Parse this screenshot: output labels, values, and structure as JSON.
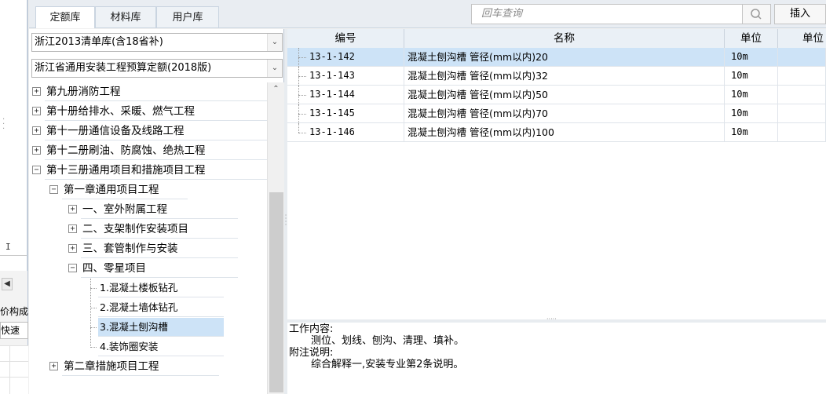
{
  "tabs": [
    "定额库",
    "材料库",
    "用户库"
  ],
  "search": {
    "placeholder": "回车查询"
  },
  "insert_label": "插入",
  "left_stub": {
    "label1": "价构成",
    "label2": "快速",
    "cursor": "I"
  },
  "library_combo": "浙江2013清单库(含18省补)",
  "quota_combo": "浙江省通用安装工程预算定额(2018版)",
  "tree": [
    {
      "label": "第九册消防工程",
      "exp": "+"
    },
    {
      "label": "第十册给排水、采暖、燃气工程",
      "exp": "+"
    },
    {
      "label": "第十一册通信设备及线路工程",
      "exp": "+"
    },
    {
      "label": "第十二册刷油、防腐蚀、绝热工程",
      "exp": "+"
    },
    {
      "label": "第十三册通用项目和措施项目工程",
      "exp": "-"
    },
    {
      "label": "第一章通用项目工程",
      "exp": "-"
    },
    {
      "label": "一、室外附属工程",
      "exp": "+"
    },
    {
      "label": "二、支架制作安装项目",
      "exp": "+"
    },
    {
      "label": "三、套管制作与安装",
      "exp": "+"
    },
    {
      "label": "四、零星项目",
      "exp": "-"
    },
    {
      "label": "1.混凝土楼板钻孔",
      "exp": ""
    },
    {
      "label": "2.混凝土墙体钻孔",
      "exp": ""
    },
    {
      "label": "3.混凝土刨沟槽",
      "exp": ""
    },
    {
      "label": "4.装饰圈安装",
      "exp": ""
    },
    {
      "label": "第二章措施项目工程",
      "exp": "+"
    }
  ],
  "table": {
    "columns": [
      "编号",
      "名称",
      "单位",
      "单位"
    ],
    "rows": [
      {
        "code": "13-1-142",
        "name": "混凝土刨沟槽 管径(mm以内)20",
        "unit": "10m"
      },
      {
        "code": "13-1-143",
        "name": "混凝土刨沟槽 管径(mm以内)32",
        "unit": "10m"
      },
      {
        "code": "13-1-144",
        "name": "混凝土刨沟槽 管径(mm以内)50",
        "unit": "10m"
      },
      {
        "code": "13-1-145",
        "name": "混凝土刨沟槽 管径(mm以内)70",
        "unit": "10m"
      },
      {
        "code": "13-1-146",
        "name": "混凝土刨沟槽 管径(mm以内)100",
        "unit": "10m"
      }
    ]
  },
  "description": {
    "work_title": "工作内容:",
    "work_text": "测位、划线、刨沟、清理、填补。",
    "note_title": "附注说明:",
    "note_text": "综合解释一,安装专业第2条说明。"
  }
}
